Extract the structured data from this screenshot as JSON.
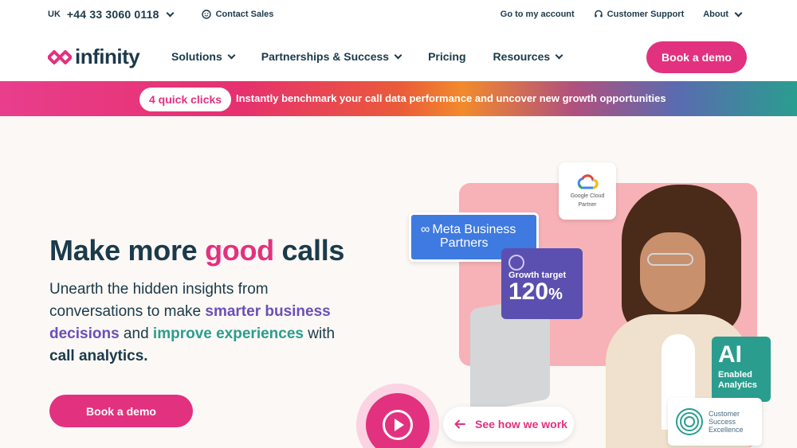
{
  "utility_bar": {
    "region": "UK",
    "phone": "+44 33 3060 0118",
    "contact_sales": "Contact Sales",
    "account": "Go to my account",
    "support": "Customer Support",
    "about": "About"
  },
  "nav": {
    "logo_text": "infinity",
    "links": [
      "Solutions",
      "Partnerships & Success",
      "Pricing",
      "Resources"
    ],
    "book_demo": "Book a demo"
  },
  "banner": {
    "pill": "4 quick clicks",
    "text": "Instantly benchmark your call data performance and uncover new growth opportunities"
  },
  "hero": {
    "title_start": "Make more ",
    "title_highlight": "good",
    "title_end": " calls",
    "sub_1": "Unearth the hidden insights from conversations to make ",
    "sub_purple": "smarter business decisions",
    "sub_2": " and ",
    "sub_teal": "improve experiences",
    "sub_3": " with ",
    "sub_bold": "call analytics.",
    "cta": "Book a demo",
    "video_cta": "See how we work"
  },
  "badges": {
    "google_line1": "Google Cloud",
    "google_line2": "Partner",
    "meta_line1": "Meta Business",
    "meta_line2": "Partners",
    "growth_label": "Growth target",
    "growth_value": "120",
    "growth_unit": "%",
    "ai_big": "AI",
    "ai_line1": "Enabled",
    "ai_line2": "Analytics",
    "cse_line1": "Customer",
    "cse_line2": "Success",
    "cse_line3": "Excellence"
  },
  "colors": {
    "brand_pink": "#e2317f",
    "navy": "#1b3a4b",
    "purple": "#6b4fb8",
    "teal": "#2a9d8f"
  }
}
